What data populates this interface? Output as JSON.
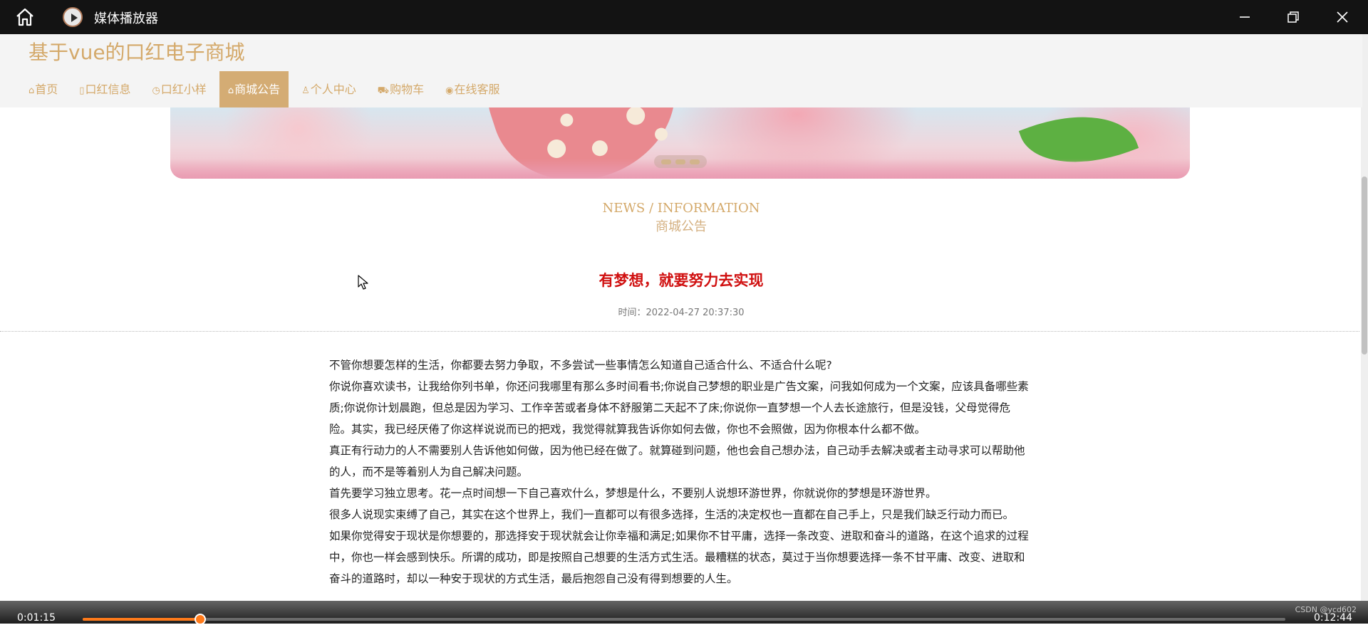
{
  "player": {
    "title": "媒体播放器",
    "current_time": "0:01:15",
    "total_time": "0:12:44",
    "progress_fraction": 0.098,
    "watermark": "CSDN @ycd602",
    "accent_color": "#ff7a1a"
  },
  "site": {
    "title": "基于vue的口红电子商城",
    "brand_color": "#d4a96a",
    "nav": [
      {
        "icon": "home-icon",
        "glyph": "⌂",
        "label": "首页",
        "active": false
      },
      {
        "icon": "lipstick-info-icon",
        "glyph": "▯",
        "label": "口红信息",
        "active": false
      },
      {
        "icon": "sample-icon",
        "glyph": "◷",
        "label": "口红小样",
        "active": false
      },
      {
        "icon": "announcement-icon",
        "glyph": "⌂",
        "label": "商城公告",
        "active": true
      },
      {
        "icon": "user-icon",
        "glyph": "♙",
        "label": "个人中心",
        "active": false
      },
      {
        "icon": "cart-icon",
        "glyph": "⛟",
        "label": "购物车",
        "active": false
      },
      {
        "icon": "service-icon",
        "glyph": "◉",
        "label": "在线客服",
        "active": false
      }
    ]
  },
  "section": {
    "english": "NEWS / INFORMATION",
    "chinese": "商城公告"
  },
  "article": {
    "title": "有梦想，就要努力去实现",
    "time": "时间：2022-04-27 20:37:30",
    "paragraphs": [
      "不管你想要怎样的生活，你都要去努力争取，不多尝试一些事情怎么知道自己适合什么、不适合什么呢?",
      "你说你喜欢读书，让我给你列书单，你还问我哪里有那么多时间看书;你说自己梦想的职业是广告文案，问我如何成为一个文案，应该具备哪些素质;你说你计划晨跑，但总是因为学习、工作辛苦或者身体不舒服第二天起不了床;你说你一直梦想一个人去长途旅行，但是没钱，父母觉得危险。其实，我已经厌倦了你这样说说而已的把戏，我觉得就算我告诉你如何去做，你也不会照做，因为你根本什么都不做。",
      "真正有行动力的人不需要别人告诉他如何做，因为他已经在做了。就算碰到问题，他也会自己想办法，自己动手去解决或者主动寻求可以帮助他的人，而不是等着别人为自己解决问题。",
      "首先要学习独立思考。花一点时间想一下自己喜欢什么，梦想是什么，不要别人说想环游世界，你就说你的梦想是环游世界。",
      "很多人说现实束缚了自己，其实在这个世界上，我们一直都可以有很多选择，生活的决定权也一直都在自己手上，只是我们缺乏行动力而已。",
      "如果你觉得安于现状是你想要的，那选择安于现状就会让你幸福和满足;如果你不甘平庸，选择一条改变、进取和奋斗的道路，在这个追求的过程中，你也一样会感到快乐。所谓的成功，即是按照自己想要的生活方式生活。最糟糕的状态，莫过于当你想要选择一条不甘平庸、改变、进取和奋斗的道路时，却以一种安于现状的方式生活，最后抱怨自己没有得到想要的人生。"
    ]
  }
}
